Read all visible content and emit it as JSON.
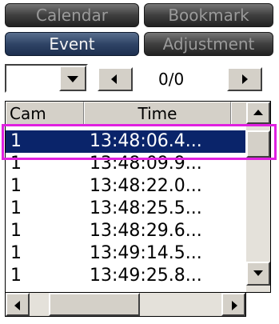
{
  "tabs": [
    {
      "label": "Calendar",
      "active": false
    },
    {
      "label": "Bookmark",
      "active": false
    },
    {
      "label": "Event",
      "active": true
    },
    {
      "label": "Adjustment",
      "active": false
    }
  ],
  "pager": {
    "counter": "0/0"
  },
  "list": {
    "columns": [
      "Cam",
      "Time"
    ],
    "rows": [
      {
        "cam": "1",
        "time": "13:48:06.4...",
        "selected": true
      },
      {
        "cam": "1",
        "time": "13:48:09.9...",
        "selected": false
      },
      {
        "cam": "1",
        "time": "13:48:22.0...",
        "selected": false
      },
      {
        "cam": "1",
        "time": "13:48:25.5...",
        "selected": false
      },
      {
        "cam": "1",
        "time": "13:48:29.6...",
        "selected": false
      },
      {
        "cam": "1",
        "time": "13:49:14.5...",
        "selected": false
      },
      {
        "cam": "1",
        "time": "13:49:25.8...",
        "selected": false
      }
    ]
  },
  "colors": {
    "highlight_outline": "#e020e0",
    "selection": "#0a246a",
    "tab_active": "#2f4466"
  }
}
